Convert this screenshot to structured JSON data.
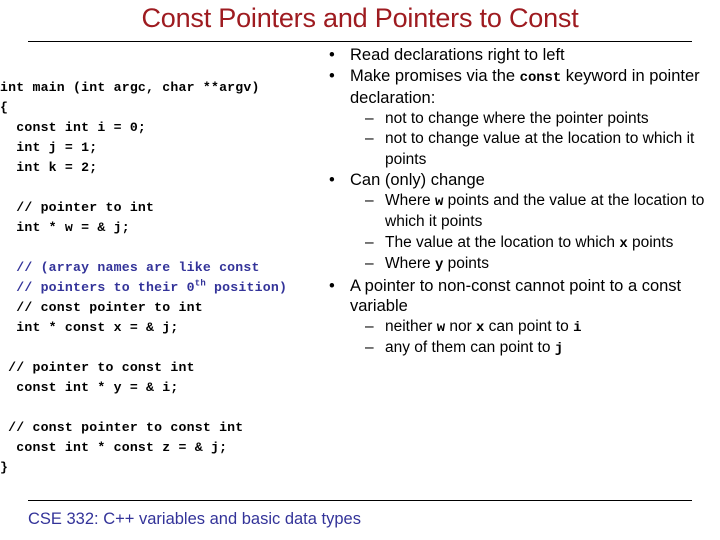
{
  "slide": {
    "title": "Const Pointers and Pointers to Const",
    "title_color": "#9e1b20",
    "footer": "CSE 332: C++ variables and basic data types",
    "footer_color": "#333399",
    "comment_color": "#333399",
    "background": "#ffffff"
  },
  "code": {
    "lines": [
      {
        "text": "int main (int argc, char **argv)",
        "style": "plain"
      },
      {
        "text": "{",
        "style": "plain"
      },
      {
        "text": "  const int i = 0;",
        "style": "plain"
      },
      {
        "text": "  int j = 1;",
        "style": "plain"
      },
      {
        "text": "  int k = 2;",
        "style": "plain"
      },
      {
        "text": "",
        "style": "blank"
      },
      {
        "text": "  // pointer to int",
        "style": "plain"
      },
      {
        "text": "  int * w = & j;",
        "style": "plain"
      },
      {
        "text": "",
        "style": "blank"
      },
      {
        "text": "  // (array names are like const",
        "style": "comment"
      },
      {
        "text": "  // pointers to their 0th position)",
        "style": "comment",
        "sup": "th"
      },
      {
        "text": "  // const pointer to int",
        "style": "plain"
      },
      {
        "text": "  int * const x = & j;",
        "style": "plain"
      },
      {
        "text": "",
        "style": "blank"
      },
      {
        "text": " // pointer to const int",
        "style": "plain"
      },
      {
        "text": "  const int * y = & i;",
        "style": "plain"
      },
      {
        "text": "",
        "style": "blank"
      },
      {
        "text": " // const pointer to const int",
        "style": "plain"
      },
      {
        "text": "  const int * const z = & j;",
        "style": "plain"
      },
      {
        "text": "}",
        "style": "plain"
      }
    ]
  },
  "bullets": [
    {
      "level": 1,
      "marker": "•",
      "parts": [
        {
          "t": "Read declarations right to left",
          "mono": false
        }
      ]
    },
    {
      "level": 1,
      "marker": "•",
      "parts": [
        {
          "t": "Make promises via the ",
          "mono": false
        },
        {
          "t": "const",
          "mono": true
        },
        {
          "t": " keyword in pointer declaration:",
          "mono": false
        }
      ]
    },
    {
      "level": 2,
      "marker": "–",
      "parts": [
        {
          "t": "not to change where the pointer points",
          "mono": false
        }
      ]
    },
    {
      "level": 2,
      "marker": "–",
      "parts": [
        {
          "t": " not to change value at the location to which it points",
          "mono": false
        }
      ]
    },
    {
      "level": 1,
      "marker": "•",
      "parts": [
        {
          "t": "Can (only) change",
          "mono": false
        }
      ]
    },
    {
      "level": 2,
      "marker": "–",
      "parts": [
        {
          "t": "Where ",
          "mono": false
        },
        {
          "t": "w",
          "mono": true
        },
        {
          "t": " points and the value at the location to which it points",
          "mono": false
        }
      ]
    },
    {
      "level": 2,
      "marker": "–",
      "parts": [
        {
          "t": "The value at the location to which ",
          "mono": false
        },
        {
          "t": "x",
          "mono": true
        },
        {
          "t": " points",
          "mono": false
        }
      ]
    },
    {
      "level": 2,
      "marker": "–",
      "parts": [
        {
          "t": "Where ",
          "mono": false
        },
        {
          "t": "y",
          "mono": true
        },
        {
          "t": " points",
          "mono": false
        }
      ]
    },
    {
      "level": 1,
      "marker": "•",
      "parts": [
        {
          "t": "A pointer to non-const cannot point to a const variable",
          "mono": false
        }
      ]
    },
    {
      "level": 2,
      "marker": "–",
      "parts": [
        {
          "t": "neither ",
          "mono": false
        },
        {
          "t": "w",
          "mono": true
        },
        {
          "t": " nor ",
          "mono": false
        },
        {
          "t": "x",
          "mono": true
        },
        {
          "t": " can point to ",
          "mono": false
        },
        {
          "t": "i",
          "mono": true
        }
      ]
    },
    {
      "level": 2,
      "marker": "–",
      "parts": [
        {
          "t": "any of them can point to ",
          "mono": false
        },
        {
          "t": "j",
          "mono": true
        }
      ]
    }
  ]
}
